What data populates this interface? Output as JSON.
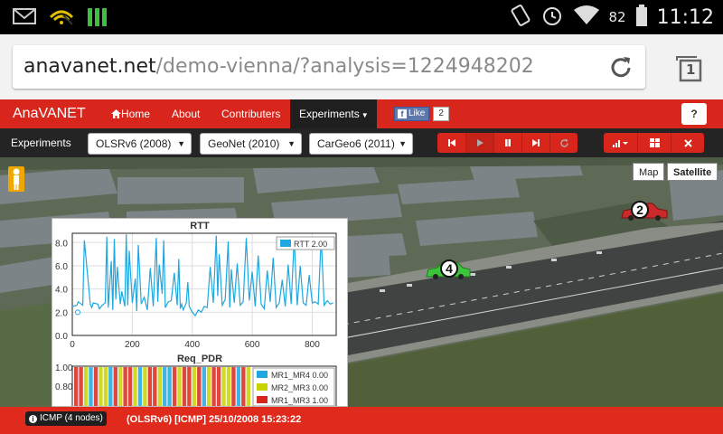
{
  "status_bar": {
    "battery_pct": "82",
    "time": "11:12"
  },
  "browser": {
    "url_host": "anavanet.net",
    "url_path": "/demo-vienna/?analysis=1224948202",
    "tab_count": "1"
  },
  "navbar": {
    "brand": "AnaVANET",
    "items": [
      {
        "label": "Home",
        "icon": "home-icon"
      },
      {
        "label": "About"
      },
      {
        "label": "Contributers"
      },
      {
        "label": "Experiments",
        "dropdown": true,
        "active": true
      }
    ],
    "like_label": "Like",
    "like_count": "2",
    "help_label": "?"
  },
  "experiments_bar": {
    "label": "Experiments",
    "selects": [
      {
        "value": "OLSRv6 (2008)"
      },
      {
        "value": "GeoNet (2010)"
      },
      {
        "value": "CarGeo6 (2011)"
      }
    ],
    "playback_icons": [
      "skip-back-icon",
      "play-icon",
      "pause-icon",
      "skip-forward-icon",
      "refresh-icon"
    ],
    "tool_icons": [
      "signal-chart-icon",
      "grid-icon",
      "close-icon"
    ]
  },
  "map": {
    "map_type_buttons": [
      "Map",
      "Satellite"
    ],
    "selected_map_type": "Satellite",
    "vehicles": [
      {
        "label": "4",
        "color": "#3cc43c"
      },
      {
        "label": "2",
        "color": "#cc2a2a"
      }
    ]
  },
  "charts": {
    "rtt": {
      "title": "RTT",
      "legend_label": "RTT 2.00"
    },
    "pdr": {
      "title": "Req_PDR",
      "legend": [
        {
          "label": "MR1_MR4 0.00",
          "color": "#1ea8e0"
        },
        {
          "label": "MR2_MR3 0.00",
          "color": "#c8d400"
        },
        {
          "label": "MR1_MR3 1.00",
          "color": "#d9261c"
        }
      ]
    }
  },
  "chart_data": [
    {
      "type": "line",
      "title": "RTT",
      "xlabel": "",
      "ylabel": "",
      "xlim": [
        0,
        880
      ],
      "ylim": [
        0,
        8.8
      ],
      "x_ticks": [
        "0",
        "200",
        "400",
        "600",
        "800"
      ],
      "y_ticks": [
        "0.0",
        "2.0",
        "4.0",
        "6.0",
        "8.0"
      ],
      "series": [
        {
          "name": "RTT 2.00",
          "color": "#1ea8e0",
          "x": [
            0,
            15,
            20,
            35,
            40,
            60,
            65,
            70,
            85,
            90,
            100,
            110,
            115,
            120,
            130,
            135,
            140,
            145,
            150,
            160,
            165,
            175,
            180,
            185,
            190,
            200,
            210,
            215,
            220,
            230,
            240,
            250,
            260,
            270,
            280,
            285,
            290,
            300,
            305,
            310,
            320,
            330,
            340,
            350,
            355,
            360,
            365,
            370,
            380,
            385,
            390,
            400,
            410,
            420,
            430,
            440,
            450,
            460,
            470,
            480,
            485,
            490,
            500,
            510,
            520,
            525,
            530,
            540,
            550,
            560,
            570,
            580,
            590,
            600,
            610,
            620,
            630,
            640,
            650,
            660,
            670,
            680,
            690,
            700,
            710,
            720,
            730,
            740,
            750,
            760,
            770,
            780,
            790,
            800,
            810,
            820,
            830,
            840,
            850,
            860,
            870
          ],
          "values": [
            2.5,
            2.6,
            2.9,
            2.6,
            8.2,
            2.7,
            2.4,
            2.8,
            2.7,
            2.3,
            2.6,
            2.8,
            8.5,
            2.4,
            6.4,
            2.2,
            8.3,
            3.1,
            5.9,
            2.7,
            3.8,
            2.5,
            8.7,
            2.6,
            7.3,
            2.8,
            4.9,
            2.1,
            7.8,
            2.7,
            3.3,
            2.2,
            5.8,
            2.5,
            8.4,
            2.9,
            6.1,
            3.6,
            8.2,
            2.4,
            2.9,
            3.0,
            5.4,
            2.6,
            6.6,
            2.3,
            2.7,
            2.2,
            2.8,
            4.6,
            2.5,
            2.0,
            1.7,
            2.2,
            2.0,
            2.5,
            2.4,
            5.9,
            2.8,
            8.6,
            3.4,
            7.0,
            2.6,
            3.1,
            8.1,
            2.4,
            5.7,
            2.8,
            6.2,
            2.6,
            2.9,
            8.4,
            3.0,
            5.5,
            2.5,
            6.9,
            2.7,
            2.3,
            5.6,
            2.9,
            6.7,
            2.4,
            2.8,
            4.8,
            2.5,
            6.1,
            2.7,
            8.3,
            2.6,
            6.0,
            2.8,
            2.6,
            5.2,
            2.8,
            2.9,
            2.7,
            8.4,
            2.6,
            3.0,
            2.7,
            2.8
          ]
        }
      ]
    },
    {
      "type": "area",
      "title": "Req_PDR",
      "xlabel": "",
      "ylabel": "",
      "ylim": [
        0,
        1.0
      ],
      "y_ticks": [
        "0.80",
        "1.00"
      ],
      "series": [
        {
          "name": "MR1_MR4 0.00",
          "color": "#1ea8e0"
        },
        {
          "name": "MR2_MR3 0.00",
          "color": "#c8d400"
        },
        {
          "name": "MR1_MR3 1.00",
          "color": "#d9261c"
        }
      ]
    }
  ],
  "footer": {
    "badge_label": "ICMP (4 nodes)",
    "status_text": "(OLSRv6) [ICMP] 25/10/2008 15:23:22"
  }
}
